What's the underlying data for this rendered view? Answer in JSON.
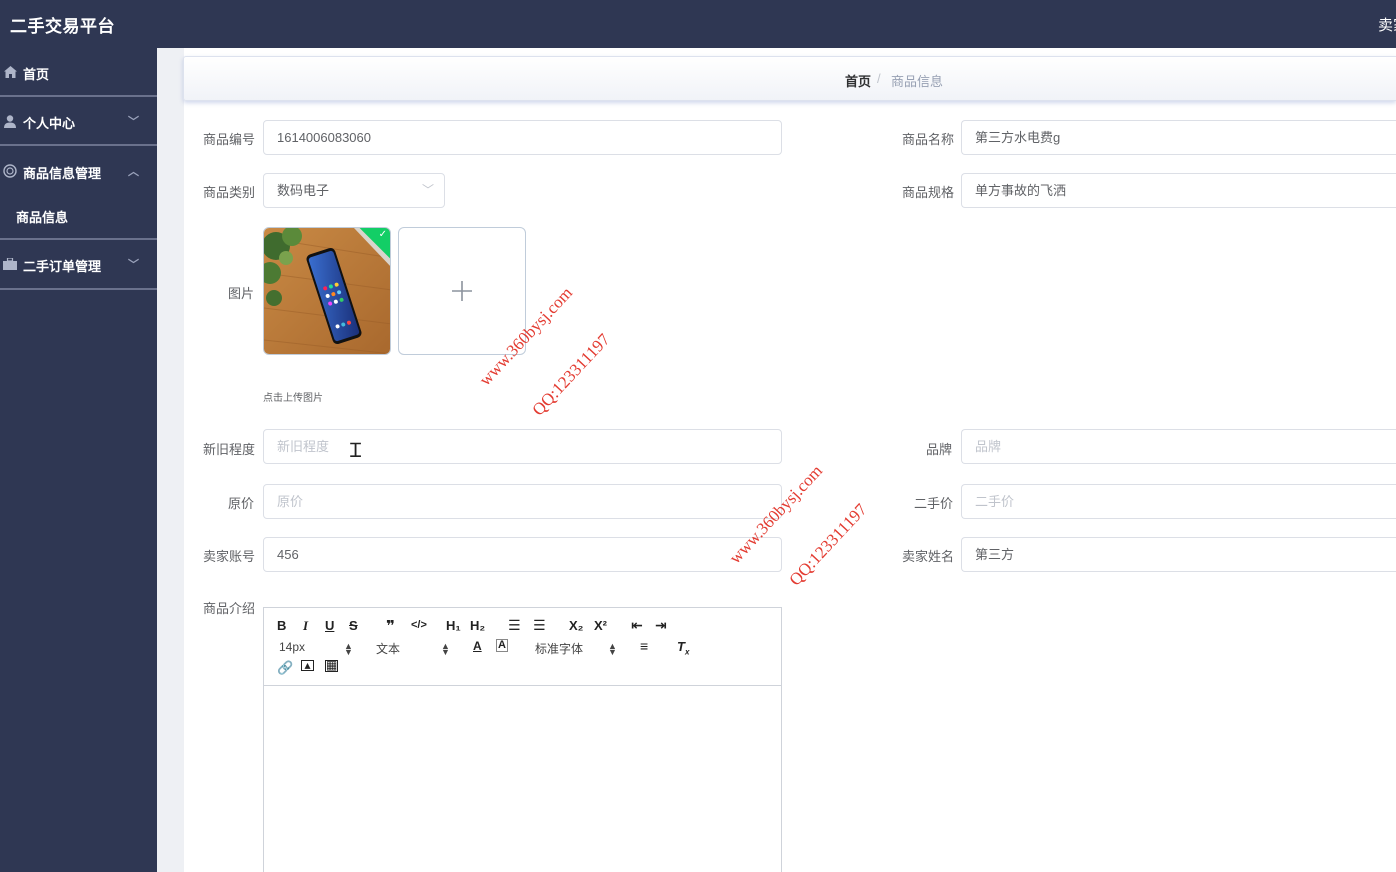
{
  "header": {
    "app_title": "二手交易平台",
    "user_label": "卖家"
  },
  "sidebar": {
    "items": [
      {
        "label": "首页",
        "icon": "home-icon"
      },
      {
        "label": "个人中心",
        "icon": "user-icon",
        "expandable": true
      },
      {
        "label": "商品信息管理",
        "icon": "goods-icon",
        "expandable": true,
        "expanded": true,
        "children": [
          {
            "label": "商品信息"
          }
        ]
      },
      {
        "label": "二手订单管理",
        "icon": "briefcase-icon",
        "expandable": true
      }
    ]
  },
  "breadcrumb": {
    "home": "首页",
    "separator": "/",
    "current": "商品信息"
  },
  "form": {
    "product_no": {
      "label": "商品编号",
      "value": "1614006083060"
    },
    "product_name": {
      "label": "商品名称",
      "value": "第三方水电费g"
    },
    "category": {
      "label": "商品类别",
      "value": "数码电子"
    },
    "spec": {
      "label": "商品规格",
      "value": "单方事故的飞洒"
    },
    "image": {
      "label": "图片",
      "upload_tip": "点击上传图片"
    },
    "condition": {
      "label": "新旧程度",
      "placeholder": "新旧程度"
    },
    "brand": {
      "label": "品牌",
      "placeholder": "品牌"
    },
    "original_price": {
      "label": "原价",
      "placeholder": "原价"
    },
    "second_price": {
      "label": "二手价",
      "placeholder": "二手价"
    },
    "seller_account": {
      "label": "卖家账号",
      "value": "456"
    },
    "seller_name": {
      "label": "卖家姓名",
      "value": "第三方"
    },
    "description": {
      "label": "商品介绍"
    }
  },
  "editor": {
    "font_size": "14px",
    "text_type": "文本",
    "font_family": "标准字体",
    "h1": "H₁",
    "h2": "H₂",
    "sub": "X₂",
    "sup": "X²"
  },
  "watermarks": [
    {
      "site": "www.360bysj.com",
      "qq": "QQ:123311197"
    },
    {
      "site": "www.360bysj.com",
      "qq": "QQ:123311197"
    }
  ],
  "colors": {
    "sidebar_bg": "#2f3753",
    "success": "#13ce66",
    "watermark": "#e0261b"
  }
}
